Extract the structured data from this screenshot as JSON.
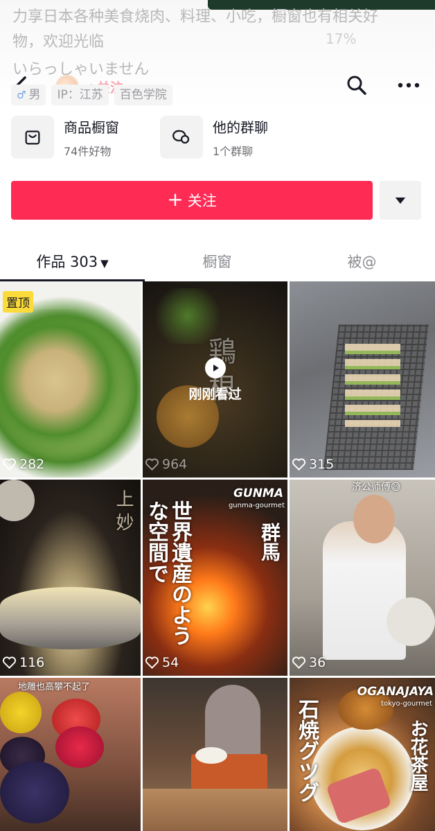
{
  "profile": {
    "bio_line1": "力享日本各种美食烧肉、料理、小吃，橱窗也有相关好",
    "bio_line2": "物，欢迎光临",
    "bio_line3": "いらっしゃいません",
    "status_ghost": "17%",
    "follow_mini": "+关注",
    "tags": {
      "gender": "男",
      "ip": "IP：江苏",
      "school": "百色学院"
    }
  },
  "features": {
    "shop": {
      "title": "商品橱窗",
      "sub": "74件好物"
    },
    "group": {
      "title": "他的群聊",
      "sub": "1个群聊"
    }
  },
  "follow_button": {
    "plus": "+",
    "label": "关注"
  },
  "tabs": {
    "works": "作品 303",
    "window": "橱窗",
    "mentioned": "被@"
  },
  "videos": [
    {
      "likes": "282",
      "badge": "置顶"
    },
    {
      "likes": "964",
      "recent": "刚刚看过",
      "overlay": "鶏 根"
    },
    {
      "likes": "315"
    },
    {
      "likes": "116",
      "overlay": "上 妙"
    },
    {
      "likes": "54",
      "overlay_main": "世界遺産のような空間で",
      "overlay_right": "群馬",
      "brand": "GUNMA",
      "brand_sub": "gunma-gourmet"
    },
    {
      "likes": "36",
      "caption": "济公师傅😅"
    },
    {
      "caption": "地雕也高攀不起了"
    },
    {},
    {
      "overlay_main": "石焼グツグ",
      "overlay_right": "お花茶屋",
      "brand": "OGANAJAYA",
      "brand_sub": "tokyo-gourmet"
    }
  ],
  "colors": {
    "accent": "#fe2c55",
    "pinned": "#fadb3a"
  }
}
